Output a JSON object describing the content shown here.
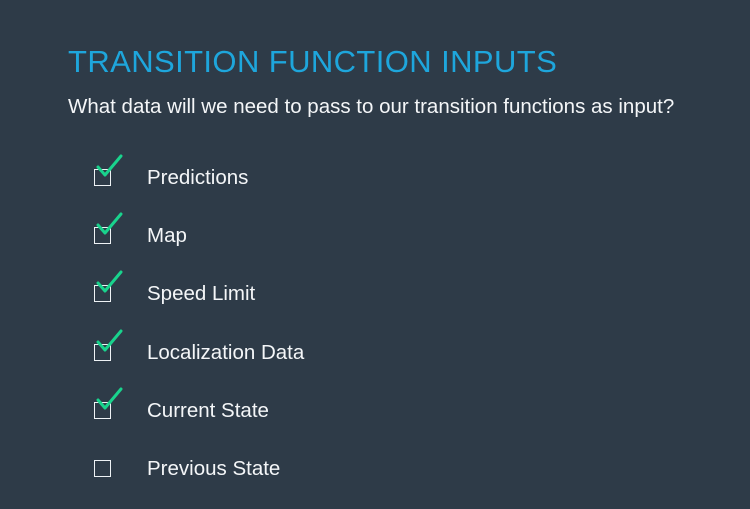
{
  "slide": {
    "title": "TRANSITION FUNCTION INPUTS",
    "subtitle": "What data will we need to pass to our transition functions as input?"
  },
  "checklist": {
    "items": [
      {
        "label": "Predictions",
        "checked": true
      },
      {
        "label": "Map",
        "checked": true
      },
      {
        "label": "Speed Limit",
        "checked": true
      },
      {
        "label": "Localization Data",
        "checked": true
      },
      {
        "label": "Current State",
        "checked": true
      },
      {
        "label": "Previous State",
        "checked": false
      }
    ]
  },
  "colors": {
    "background": "#2e3b48",
    "title": "#1ea6dc",
    "text": "#f4f6f8",
    "check": "#19d38d",
    "box": "#eef2f5"
  },
  "icons": {
    "checkbox": "checkbox-icon",
    "check": "checkmark-icon"
  }
}
